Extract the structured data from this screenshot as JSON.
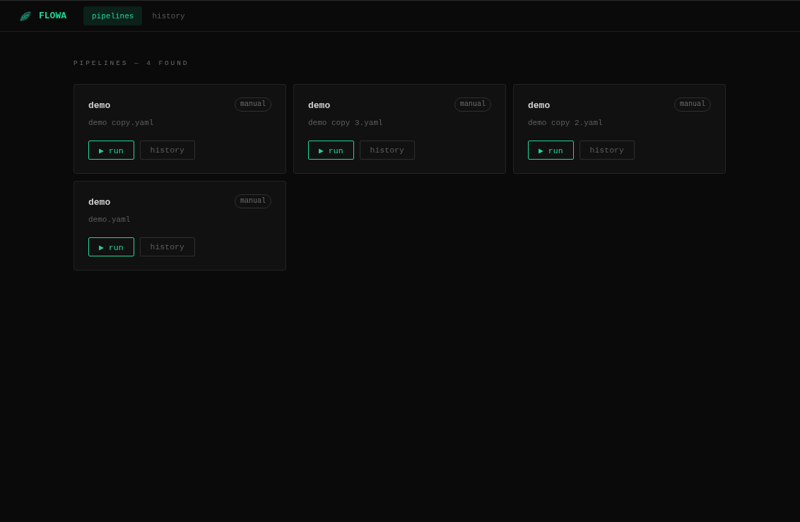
{
  "header": {
    "brand": "FLOWA",
    "nav": [
      {
        "label": "pipelines",
        "selected": true
      },
      {
        "label": "history",
        "selected": false
      }
    ]
  },
  "heading": "PIPELINES — 4 FOUND",
  "pipelines": [
    {
      "name": "demo",
      "trigger": "manual",
      "file": "demo copy.yaml",
      "actions": [
        {
          "kind": "primary",
          "label": "▶ run"
        },
        {
          "kind": "secondary",
          "label": "history"
        }
      ]
    },
    {
      "name": "demo",
      "trigger": "manual",
      "file": "demo copy 3.yaml",
      "actions": [
        {
          "kind": "primary",
          "label": "▶ run"
        },
        {
          "kind": "secondary",
          "label": "history"
        }
      ]
    },
    {
      "name": "demo",
      "trigger": "manual",
      "file": "demo copy 2.yaml",
      "actions": [
        {
          "kind": "primary",
          "label": "▶ run"
        },
        {
          "kind": "secondary",
          "label": "history"
        }
      ]
    },
    {
      "name": "demo",
      "trigger": "manual",
      "file": "demo.yaml",
      "actions": [
        {
          "kind": "primary",
          "label": "▶ run"
        },
        {
          "kind": "secondary",
          "label": "history"
        }
      ]
    }
  ]
}
